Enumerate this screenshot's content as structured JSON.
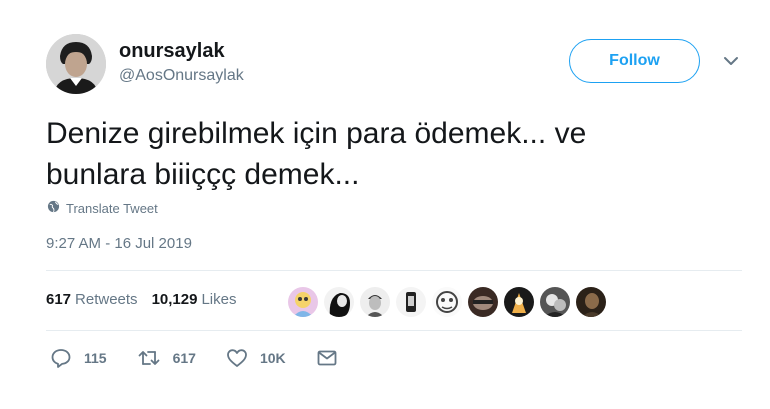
{
  "user": {
    "display_name": "onursaylak",
    "handle": "@AosOnursaylak"
  },
  "follow_button": {
    "label": "Follow"
  },
  "tweet": {
    "line1": "Denize girebilmek için para ödemek... ve",
    "line2": "bunlara biiiççç demek...",
    "translate_label": "Translate Tweet",
    "timestamp": "9:27 AM - 16 Jul 2019"
  },
  "stats": {
    "retweets_count": "617",
    "retweets_label": "Retweets",
    "likes_count": "10,129",
    "likes_label": "Likes"
  },
  "actions": {
    "reply_count": "115",
    "retweet_count": "617",
    "like_count": "10K"
  },
  "colors": {
    "accent": "#1da1f2",
    "muted": "#657786",
    "text": "#14171a",
    "divider": "#e6ecf0"
  },
  "icons": [
    "globe-icon",
    "chevron-down-icon",
    "reply-icon",
    "retweet-icon",
    "heart-icon",
    "dm-icon"
  ]
}
